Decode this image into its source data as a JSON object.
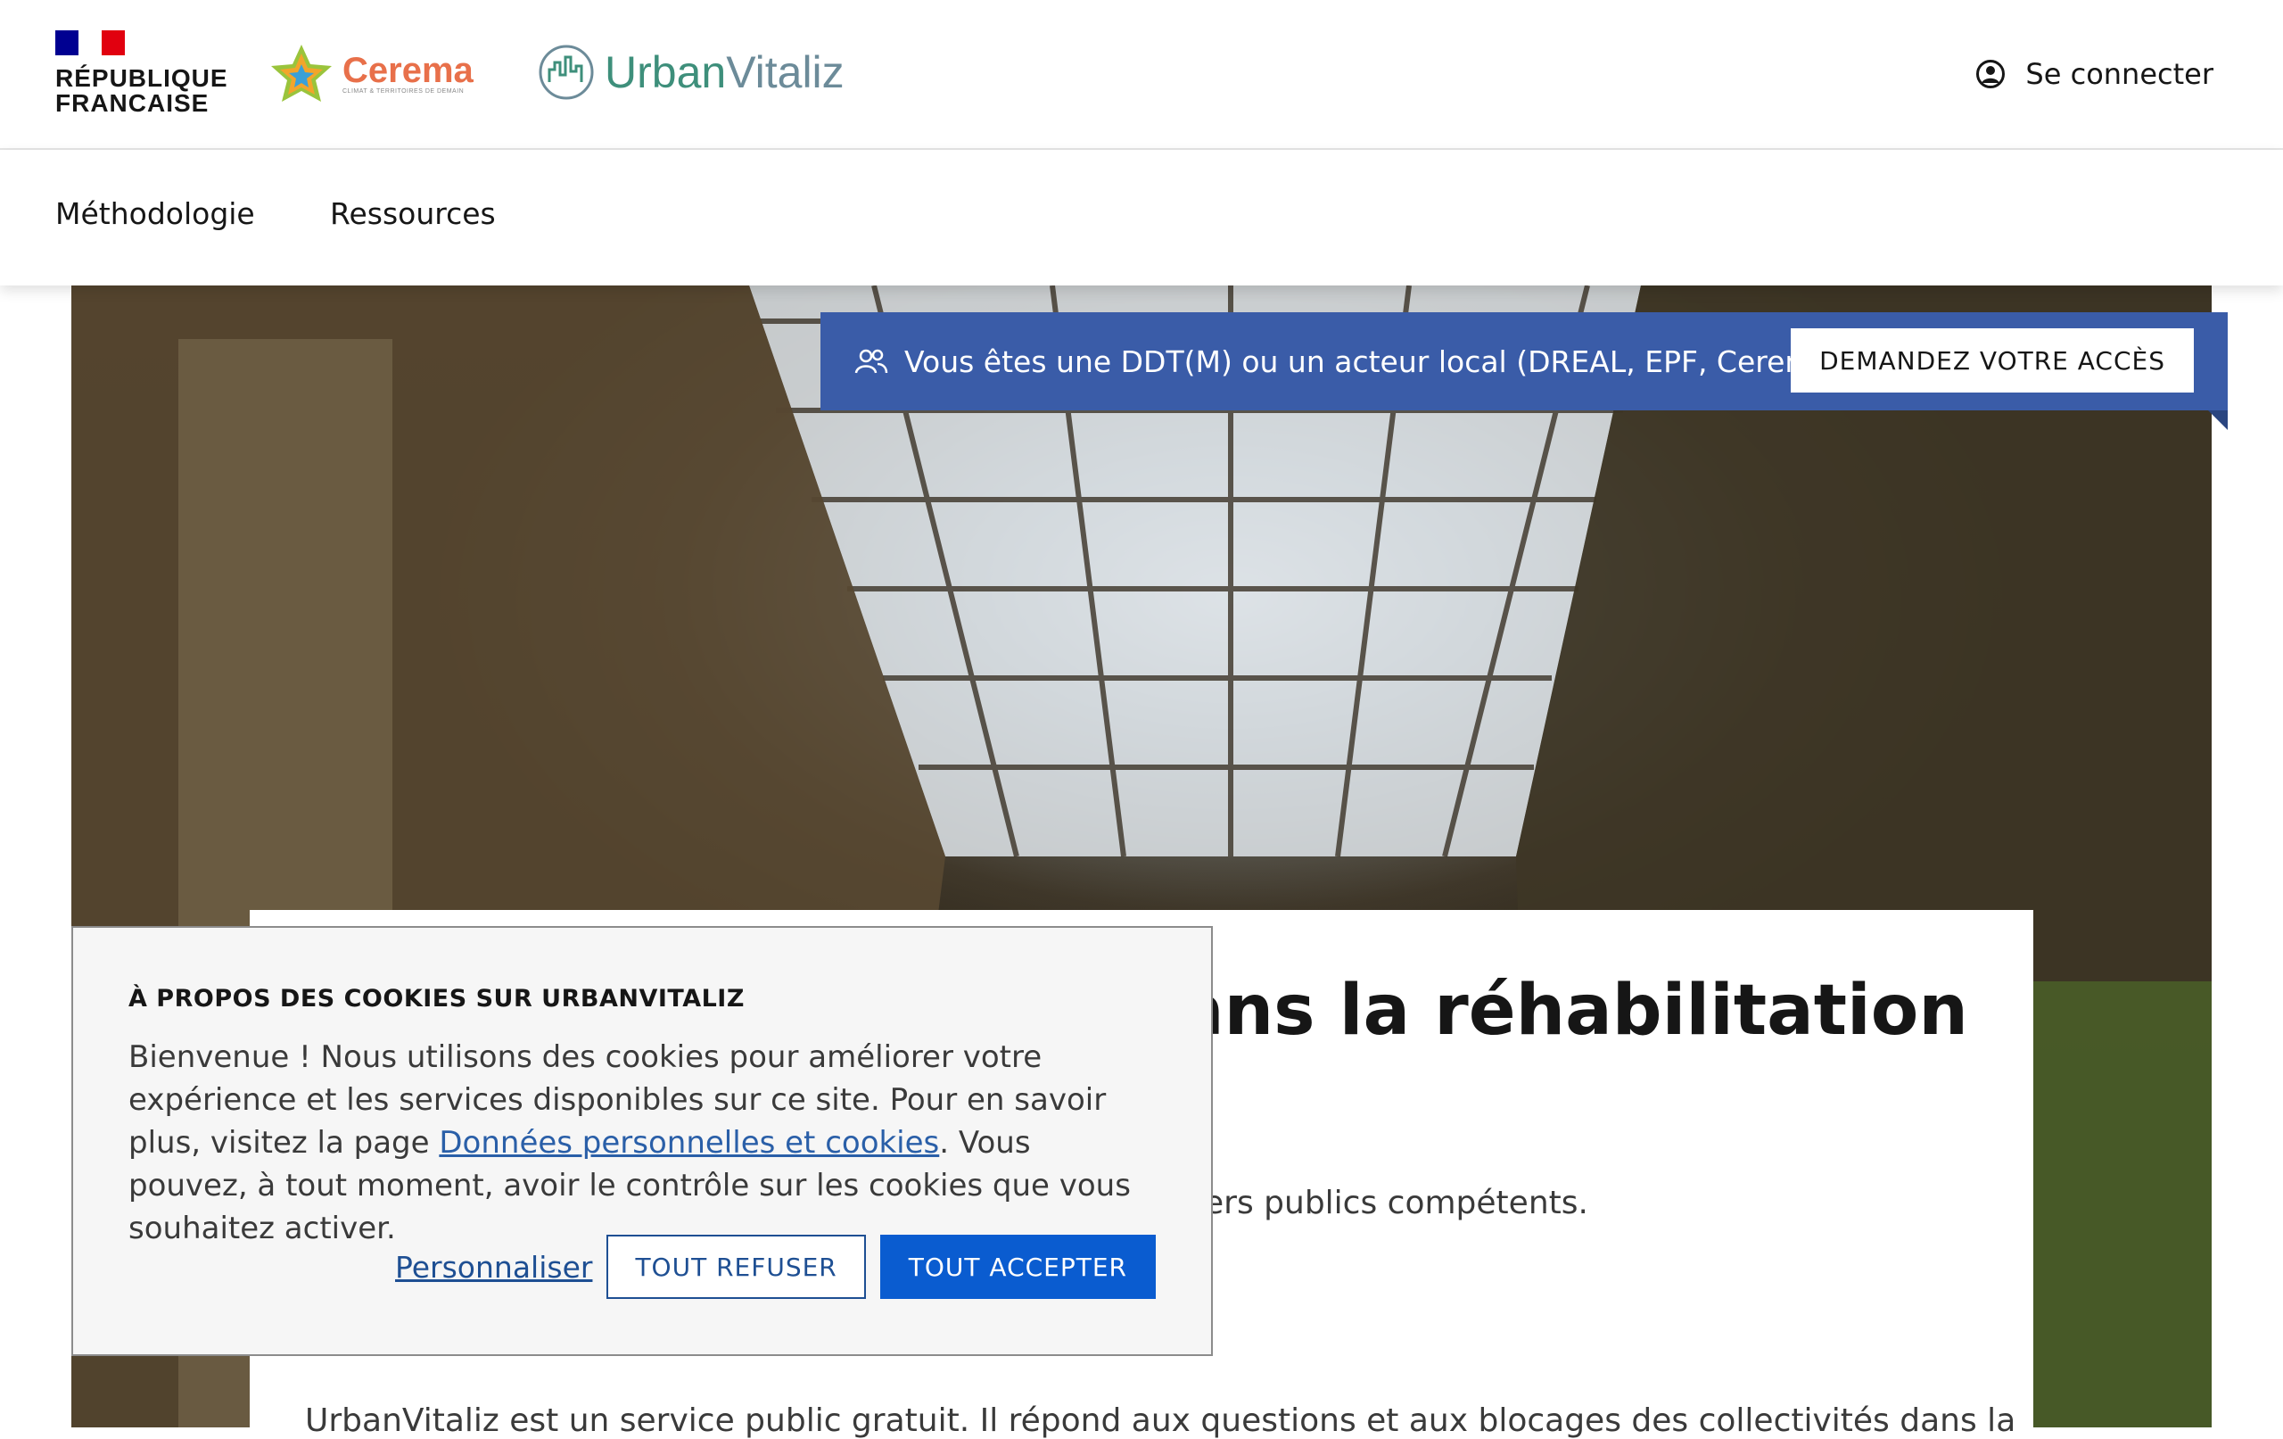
{
  "header": {
    "rf_line1": "RÉPUBLIQUE",
    "rf_line2": "FRANCAISE",
    "cerema_name": "Cerema",
    "cerema_tagline": "CLIMAT & TERRITOIRES DE DEMAIN",
    "uv_part1": "Urban",
    "uv_part2": "Vitaliz",
    "login_label": "Se connecter"
  },
  "nav": {
    "items": [
      "Méthodologie",
      "Ressources"
    ]
  },
  "banner": {
    "text": "Vous êtes une DDT(M) ou un acteur local (DREAL, EPF, Cerema...) ?",
    "button": "DEMANDEZ VOTRE ACCÈS"
  },
  "hero_card": {
    "title_visible": "ans la réhabilitation",
    "subtitle_visible": "illers publics compétents.",
    "body_visible": "UrbanVitaliz est un service public gratuit. Il répond aux questions et aux blocages des collectivités dans la"
  },
  "cookie": {
    "title": "À PROPOS DES COOKIES SUR URBANVITALIZ",
    "text_before_link": "Bienvenue ! Nous utilisons des cookies pour améliorer votre expérience et les services disponibles sur ce site. Pour en savoir plus, visitez la page ",
    "link": "Données personnelles et cookies",
    "text_after_link": ". Vous pouvez, à tout moment, avoir le contrôle sur les cookies que vous souhaitez activer.",
    "customize": "Personnaliser",
    "refuse": "TOUT REFUSER",
    "accept": "TOUT ACCEPTER"
  },
  "colors": {
    "banner_blue": "#3a5ca8",
    "accept_blue": "#0a5cd0",
    "link_blue": "#1e4f93",
    "accent_teal": "#2f8f95"
  }
}
